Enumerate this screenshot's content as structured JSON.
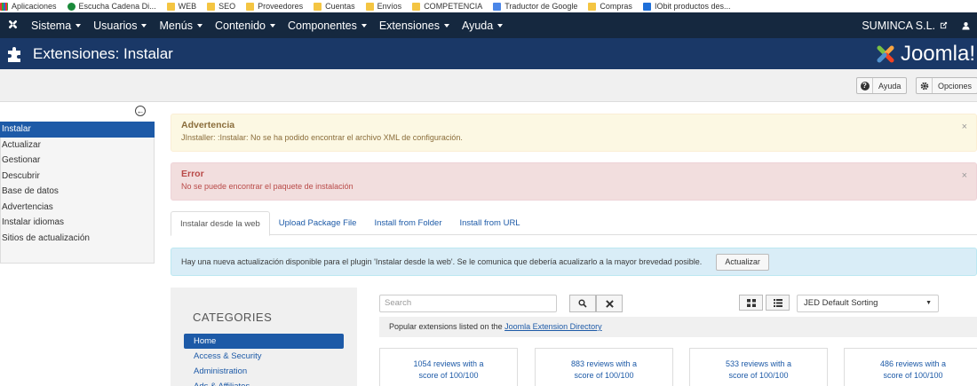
{
  "bookmarks": [
    {
      "label": "Aplicaciones",
      "icon": "apps-icon"
    },
    {
      "label": "Escucha Cadena Di...",
      "icon": "radio-icon"
    },
    {
      "label": "WEB",
      "icon": "folder-icon"
    },
    {
      "label": "SEO",
      "icon": "folder-icon"
    },
    {
      "label": "Proveedores",
      "icon": "folder-icon"
    },
    {
      "label": "Cuentas",
      "icon": "folder-icon"
    },
    {
      "label": "Envíos",
      "icon": "folder-icon"
    },
    {
      "label": "COMPETENCIA",
      "icon": "folder-icon"
    },
    {
      "label": "Traductor de Google",
      "icon": "translate-icon"
    },
    {
      "label": "Compras",
      "icon": "folder-icon"
    },
    {
      "label": "IObit productos des...",
      "icon": "iobit-icon"
    }
  ],
  "navbar": {
    "menus": [
      "Sistema",
      "Usuarios",
      "Menús",
      "Contenido",
      "Componentes",
      "Extensiones",
      "Ayuda"
    ],
    "site_name": "SUMINCA S.L."
  },
  "header": {
    "title": "Extensiones: Instalar",
    "brand": "Joomla!"
  },
  "toolbar": {
    "help_label": "Ayuda",
    "options_label": "Opciones"
  },
  "sidebar": {
    "items": [
      "Instalar",
      "Actualizar",
      "Gestionar",
      "Descubrir",
      "Base de datos",
      "Advertencias",
      "Instalar idiomas",
      "Sitios de actualización"
    ]
  },
  "alerts": {
    "warning_title": "Advertencia",
    "warning_text": "JInstaller: :Instalar: No se ha podido encontrar el archivo XML de configuración.",
    "error_title": "Error",
    "error_text": "No se puede encontrar el paquete de instalación"
  },
  "tabs": [
    "Instalar desde la web",
    "Upload Package File",
    "Install from Folder",
    "Install from URL"
  ],
  "update_notice": {
    "text": "Hay una nueva actualización disponible para el plugin 'Instalar desde la web'. Se le comunica que debería acualizarlo a la mayor brevedad posible.",
    "button": "Actualizar"
  },
  "categories": {
    "title": "CATEGORIES",
    "items": [
      "Home",
      "Access & Security",
      "Administration",
      "Ads & Affiliates"
    ]
  },
  "jed": {
    "search_placeholder": "Search",
    "sort_selected": "JED Default Sorting",
    "popular_prefix": "Popular extensions listed on the ",
    "popular_link": "Joomla Extension Directory"
  },
  "cards": [
    {
      "line1": "1054 reviews with a",
      "line2": "score of 100/100"
    },
    {
      "line1": "883 reviews with a",
      "line2": "score of 100/100"
    },
    {
      "line1": "533 reviews with a",
      "line2": "score of 100/100"
    },
    {
      "line1": "486 reviews with a",
      "line2": "score of 100/100"
    }
  ]
}
